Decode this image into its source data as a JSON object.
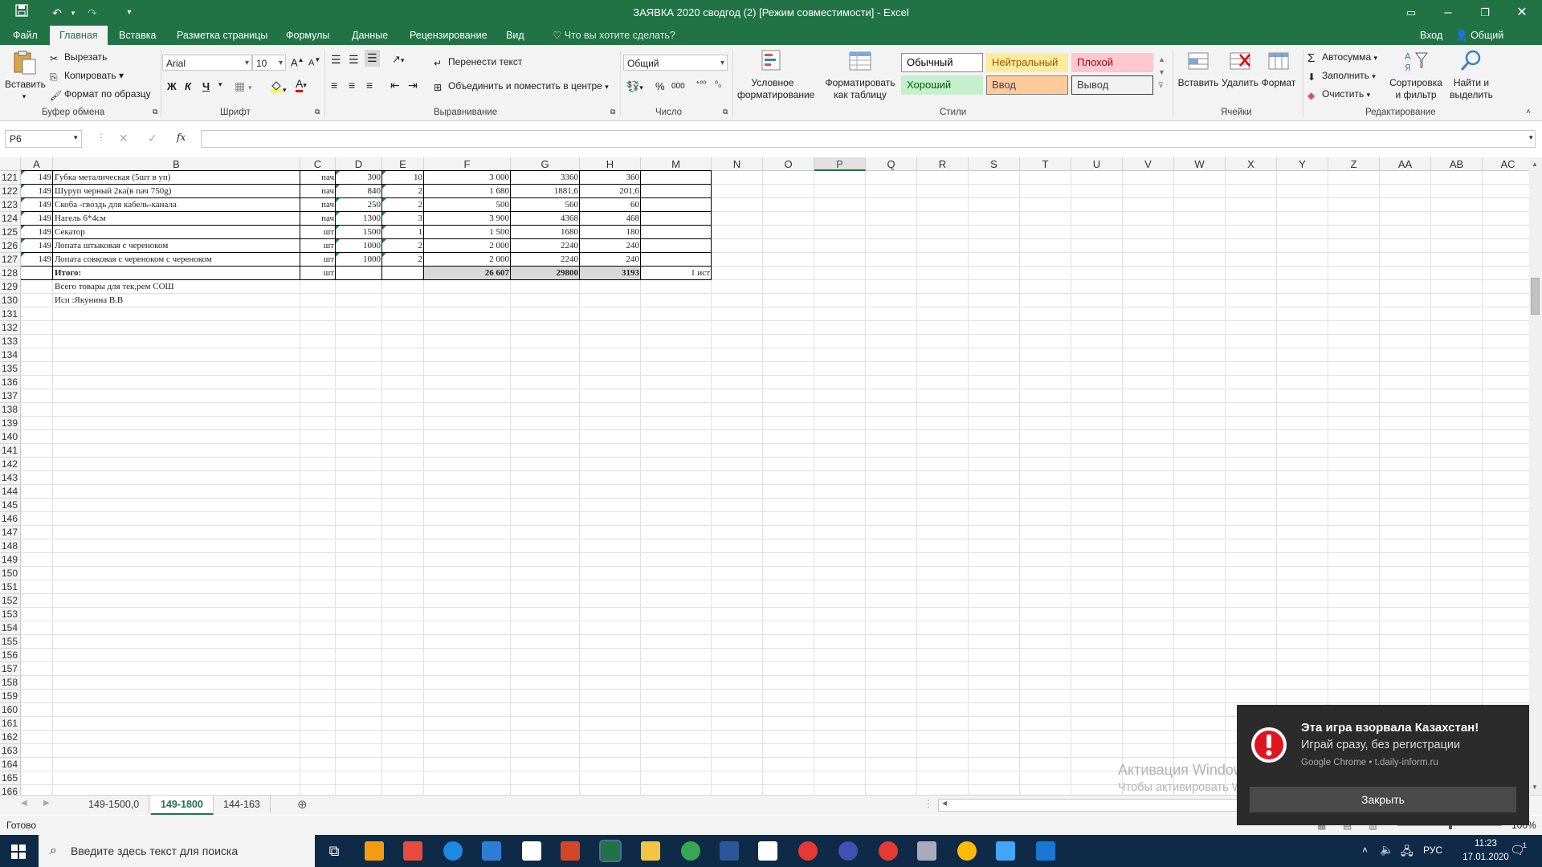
{
  "window": {
    "title": "ЗАЯВКА 2020 сводгод (2)  [Режим совместимости] - Excel",
    "quick_access_customize": "▾"
  },
  "ribbon_tabs": [
    {
      "label": "Файл"
    },
    {
      "label": "Главная",
      "active": true
    },
    {
      "label": "Вставка"
    },
    {
      "label": "Разметка страницы"
    },
    {
      "label": "Формулы"
    },
    {
      "label": "Данные"
    },
    {
      "label": "Рецензирование"
    },
    {
      "label": "Вид"
    }
  ],
  "tell_me": "Что вы хотите сделать?",
  "signin": "Вход",
  "share": "Общий доступ",
  "clipboard": {
    "paste": "Вставить",
    "cut": "Вырезать",
    "copy": "Копировать",
    "format_painter": "Формат по образцу",
    "group": "Буфер обмена"
  },
  "font": {
    "name": "Arial",
    "size": "10",
    "bold": "Ж",
    "italic": "К",
    "underline": "Ч",
    "group": "Шрифт"
  },
  "alignment": {
    "wrap": "Перенести текст",
    "merge": "Объединить и поместить в центре",
    "group": "Выравнивание"
  },
  "number": {
    "format": "Общий",
    "group": "Число",
    "percent": "%",
    "thousands": "000"
  },
  "styles": {
    "conditional": "Условное форматирование",
    "as_table": "Форматировать как таблицу",
    "cells": [
      {
        "label": "Обычный",
        "bg": "#ffffff",
        "color": "#000000",
        "border": "#8a8a8a"
      },
      {
        "label": "Нейтральный",
        "bg": "#ffeb9c",
        "color": "#9c5700",
        "border": "#ffeb9c"
      },
      {
        "label": "Плохой",
        "bg": "#ffc7ce",
        "color": "#9c0006",
        "border": "#ffc7ce"
      },
      {
        "label": "Хороший",
        "bg": "#c6efce",
        "color": "#006100",
        "border": "#c6efce"
      },
      {
        "label": "Ввод",
        "bg": "#ffcc99",
        "color": "#3f3f76",
        "border": "#7f7f7f"
      },
      {
        "label": "Вывод",
        "bg": "#f2f2f2",
        "color": "#3f3f3f",
        "border": "#3f3f3f"
      }
    ],
    "group": "Стили"
  },
  "cells_group": {
    "insert": "Вставить",
    "delete": "Удалить",
    "format": "Формат",
    "group": "Ячейки"
  },
  "editing": {
    "autosum": "Автосумма",
    "fill": "Заполнить",
    "clear": "Очистить",
    "sort": "Сортировка и фильтр",
    "find": "Найти и выделить",
    "group": "Редактирование"
  },
  "formula_bar": {
    "name_box": "P6",
    "fx": "fx",
    "value": ""
  },
  "columns": [
    "A",
    "B",
    "C",
    "D",
    "E",
    "F",
    "G",
    "H",
    "M",
    "N",
    "O",
    "P",
    "Q",
    "R",
    "S",
    "T",
    "U",
    "V",
    "W",
    "X",
    "Y",
    "Z",
    "AA",
    "AB",
    "AC"
  ],
  "selected_column": "P",
  "first_row": 121,
  "last_row": 166,
  "data_rows": [
    {
      "row": 121,
      "A": "149",
      "B": "Губка металическая (5шт в уп)",
      "C": "пач",
      "D": "300",
      "E": "10",
      "F": "3 000",
      "G": "3360",
      "H": "360"
    },
    {
      "row": 122,
      "A": "149",
      "B": "Шуруп черный 2ка(в пач 750g)",
      "C": "пач",
      "D": "840",
      "E": "2",
      "F": "1 680",
      "G": "1881,6",
      "H": "201,6"
    },
    {
      "row": 123,
      "A": "149",
      "B": "Скоба -гвоздь для кабель-канала",
      "C": "пач",
      "D": "250",
      "E": "2",
      "F": "500",
      "G": "560",
      "H": "60"
    },
    {
      "row": 124,
      "A": "149",
      "B": "Нагель 6*4см",
      "C": "пач",
      "D": "1300",
      "E": "3",
      "F": "3 900",
      "G": "4368",
      "H": "468"
    },
    {
      "row": 125,
      "A": "149",
      "B": "Секатор",
      "C": "шт",
      "D": "1500",
      "E": "1",
      "F": "1 500",
      "G": "1680",
      "H": "180"
    },
    {
      "row": 126,
      "A": "149",
      "B": "Лопата штыковая с череноком",
      "C": "шт",
      "D": "1000",
      "E": "2",
      "F": "2 000",
      "G": "2240",
      "H": "240"
    },
    {
      "row": 127,
      "A": "149",
      "B": "Лопата совковая с череноком с череноком",
      "C": "шт",
      "D": "1000",
      "E": "2",
      "F": "2 000",
      "G": "2240",
      "H": "240"
    }
  ],
  "total_row": {
    "row": 128,
    "B": "Итого:",
    "C": "шт",
    "F": "26 607",
    "G": "29800",
    "H": "3193",
    "M": "1 ист"
  },
  "note_rows": [
    {
      "row": 129,
      "B": "Всего  товары для тек,рем СОШ"
    },
    {
      "row": 130,
      "B": "Исп :Якунина В.В"
    }
  ],
  "sheets": [
    {
      "label": "149-1500,0"
    },
    {
      "label": "149-1800",
      "active": true
    },
    {
      "label": "144-163"
    }
  ],
  "status": "Готово",
  "zoom": "100%",
  "watermark": {
    "line1": "Активация Windows",
    "line2": "Чтобы активировать Windows, перейдите в раздел \"Параметры\"."
  },
  "toast": {
    "title": "Эта игра взорвала Казахстан!",
    "body": "Играй сразу, без регистрации",
    "source": "Google Chrome • t.daily-inform.ru",
    "button": "Закрыть"
  },
  "taskbar": {
    "search_placeholder": "Введите здесь текст для поиска",
    "lang": "РУС",
    "time": "11:23",
    "date": "17.01.2020",
    "notif_count": "1"
  }
}
